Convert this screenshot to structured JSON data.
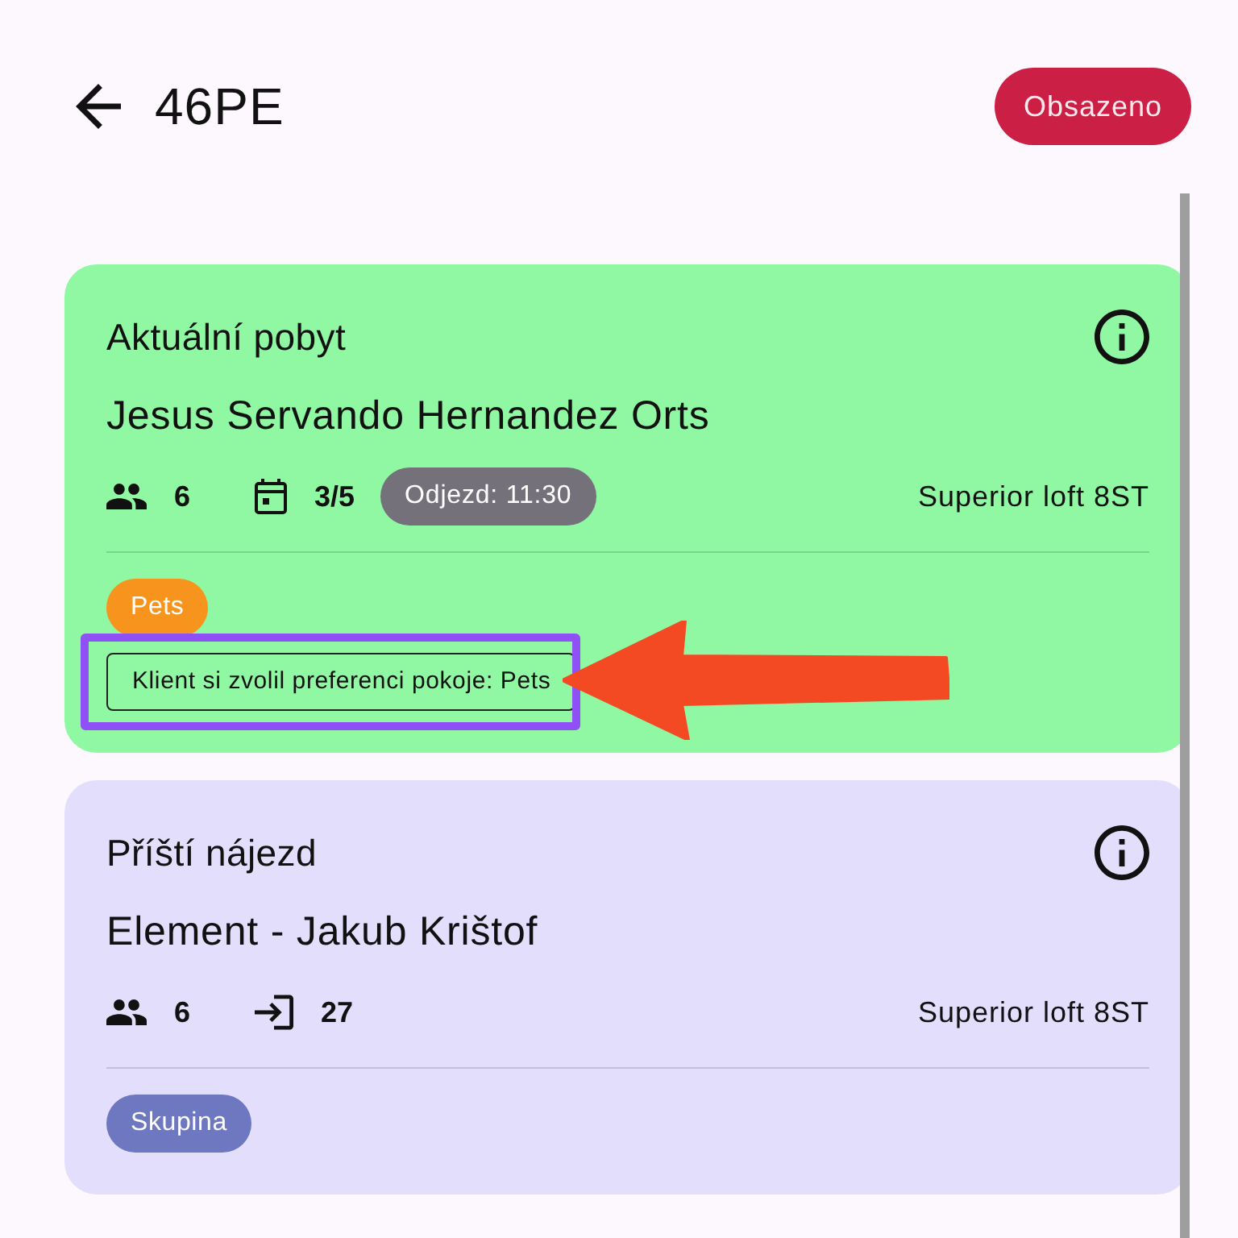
{
  "header": {
    "title": "46PE",
    "status_button": "Obsazeno"
  },
  "cards": [
    {
      "kind": "current",
      "title": "Aktuální pobyt",
      "guest": "Jesus Servando Hernandez Orts",
      "stats": [
        {
          "kind": "guests",
          "value": "6"
        },
        {
          "kind": "nights",
          "value": "3/5"
        }
      ],
      "badge": "Odjezd: 11:30",
      "room": "Superior loft 8ST",
      "tags": [
        {
          "label": "Pets",
          "color": "#f7941d"
        }
      ],
      "notes": [
        {
          "text": "Klient si zvolil preferenci pokoje: Pets",
          "highlight_frame": true,
          "pointer_arrow": true
        }
      ]
    },
    {
      "kind": "next",
      "title": "Příští nájezd",
      "guest": "Element - Jakub Krištof",
      "stats": [
        {
          "kind": "guests",
          "value": "6"
        },
        {
          "kind": "arrival",
          "value": "27"
        }
      ],
      "room": "Superior loft 8ST",
      "tags": [
        {
          "label": "Skupina",
          "color": "#6e78c0"
        }
      ]
    }
  ]
}
